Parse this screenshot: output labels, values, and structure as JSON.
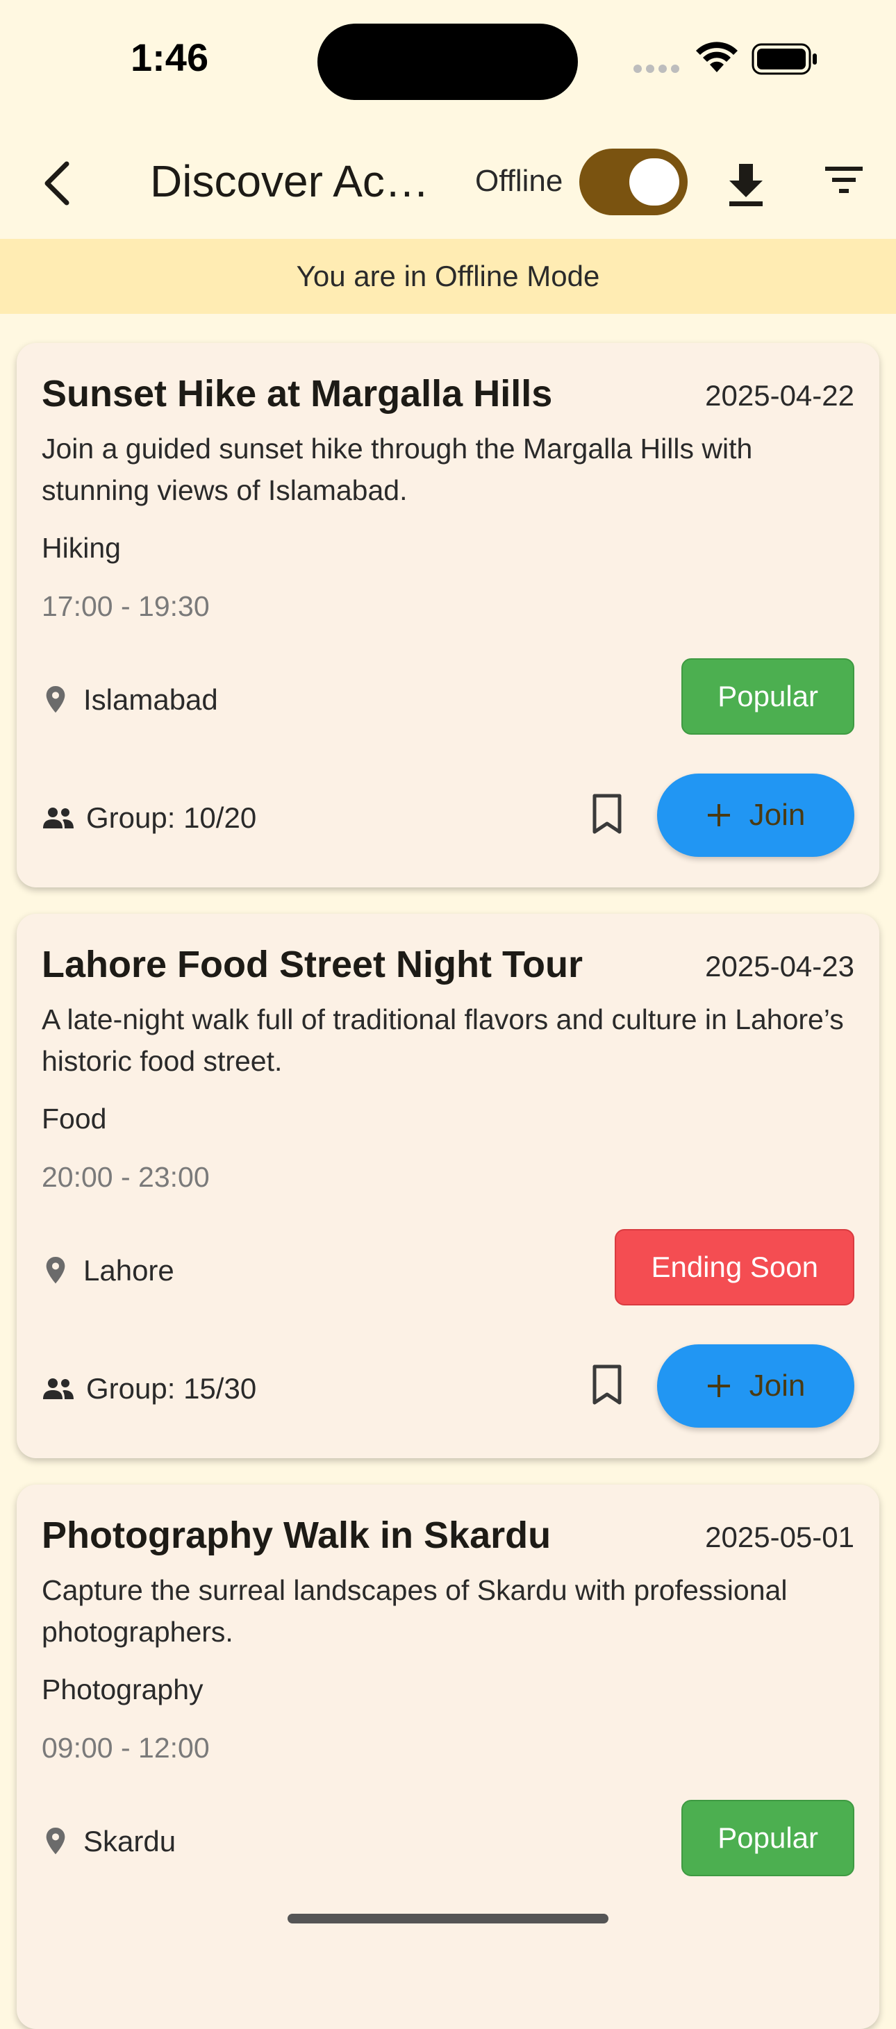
{
  "status_bar": {
    "time": "1:46"
  },
  "app_bar": {
    "title": "Discover Activities",
    "offline_label": "Offline",
    "offline_toggle_on": true
  },
  "banner": {
    "text": "You are in Offline Mode"
  },
  "colors": {
    "background": "#FFF8E1",
    "banner": "#FFECB3",
    "card": "#FCF1E5",
    "toggle": "#7A5310",
    "join": "#2196F3",
    "popular": "#4CAF50",
    "ending_soon": "#F44D52"
  },
  "activities": [
    {
      "title": "Sunset Hike at Margalla Hills",
      "date": "2025-04-22",
      "description": "Join a guided sunset hike through the Margalla Hills with stunning views of Islamabad.",
      "category": "Hiking",
      "time": "17:00 - 19:30",
      "location": "Islamabad",
      "badge": "Popular",
      "group": "Group: 10/20",
      "join_label": "Join"
    },
    {
      "title": "Lahore Food Street Night Tour",
      "date": "2025-04-23",
      "description": "A late-night walk full of traditional flavors and culture in Lahore’s historic food street.",
      "category": "Food",
      "time": "20:00 - 23:00",
      "location": "Lahore",
      "badge": "Ending Soon",
      "group": "Group: 15/30",
      "join_label": "Join"
    },
    {
      "title": "Photography Walk in Skardu",
      "date": "2025-05-01",
      "description": "Capture the surreal landscapes of Skardu with professional photographers.",
      "category": "Photography",
      "time": "09:00 - 12:00",
      "location": "Skardu",
      "badge": "Popular",
      "group": "",
      "join_label": ""
    }
  ]
}
